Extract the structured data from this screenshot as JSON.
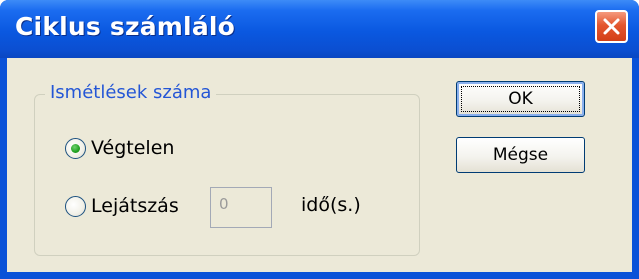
{
  "window": {
    "title": "Ciklus számláló",
    "close_icon": "close-icon",
    "titlebar_color": "#0a58e0",
    "client_color": "#ece9d8"
  },
  "group": {
    "legend": "Ismétlések száma",
    "legend_color": "#2456d6",
    "options": [
      {
        "label": "Végtelen",
        "selected": true
      },
      {
        "label": "Lejátszás",
        "selected": false
      }
    ],
    "count_input": {
      "value": "0",
      "enabled": false
    },
    "unit_label": "idő(s.)"
  },
  "buttons": {
    "ok_label": "OK",
    "cancel_label": "Mégse"
  }
}
